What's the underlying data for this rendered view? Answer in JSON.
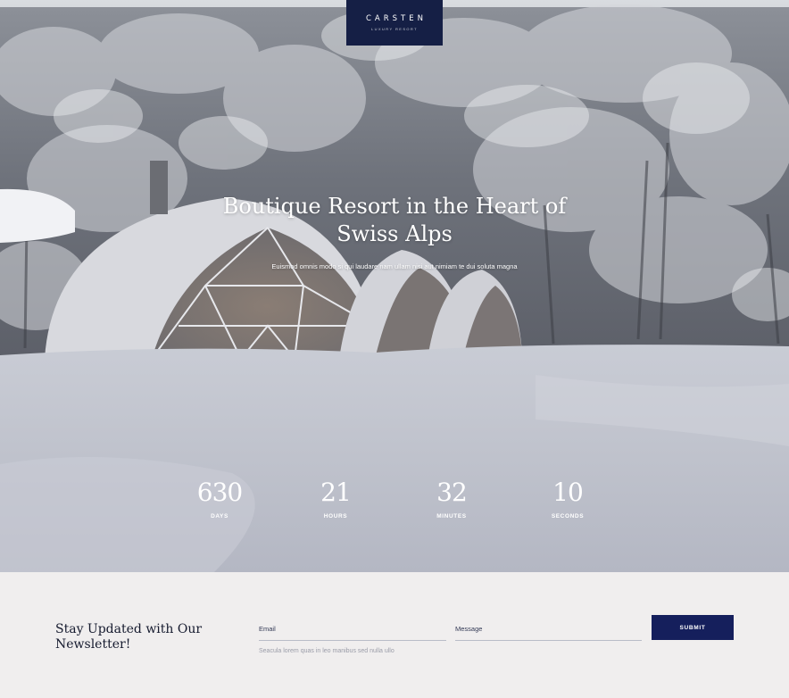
{
  "brand": {
    "name": "CARSTEN",
    "tagline": "LUXURY RESORT",
    "color": "#151f45"
  },
  "hero": {
    "title": "Boutique Resort in the Heart of Swiss Alps",
    "subtitle": "Euismod omnis modo si qui laudare nam ullam nisi aut nimiam te dui soluta magna"
  },
  "countdown": {
    "days": {
      "value": "630",
      "label": "DAYS"
    },
    "hours": {
      "value": "21",
      "label": "HOURS"
    },
    "minutes": {
      "value": "32",
      "label": "MINUTES"
    },
    "seconds": {
      "value": "10",
      "label": "SECONDS"
    }
  },
  "newsletter": {
    "title": "Stay Updated with Our Newsletter!",
    "email_label": "Email",
    "message_label": "Message",
    "note": "Seacula lorem quas in leo manibus sed nulla ullo",
    "submit_label": "SUBMIT",
    "button_color": "#151f5c",
    "background": "#f0eeee"
  }
}
